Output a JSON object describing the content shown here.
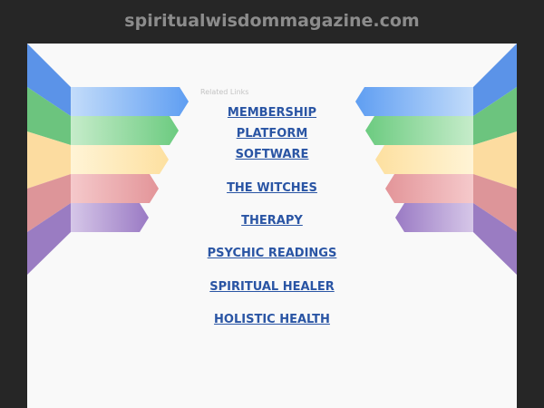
{
  "header": {
    "domain": "spiritualwisdommagazine.com"
  },
  "main": {
    "related_label": "Related Links",
    "links": [
      "MEMBERSHIP",
      "PLATFORM",
      "SOFTWARE",
      "THE WITCHES",
      "THERAPY",
      "PSYCHIC READINGS",
      "SPIRITUAL HEALER",
      "HOLISTIC HEALTH"
    ]
  },
  "colors": {
    "background": "#262626",
    "panel": "#f9f9f9",
    "link": "#2a55a4",
    "ribbon_blue": "#6aa4f2",
    "ribbon_green": "#7fcf8b",
    "ribbon_yellow": "#fde6a6",
    "ribbon_red": "#e9a0a4",
    "ribbon_purple": "#a98cc9"
  }
}
